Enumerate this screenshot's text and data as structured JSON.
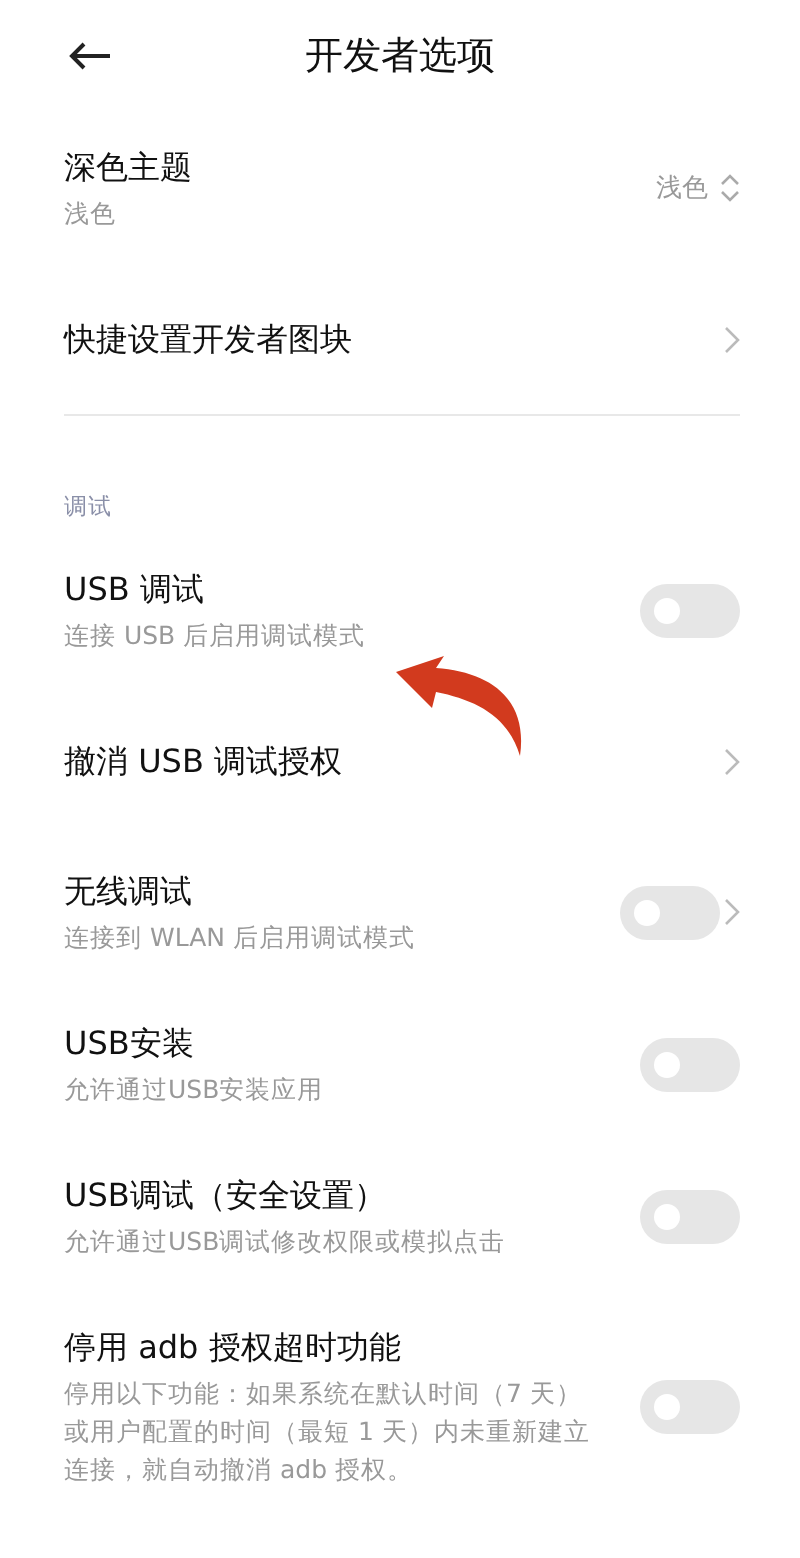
{
  "header": {
    "title": "开发者选项"
  },
  "groups": [
    {
      "items": [
        {
          "kind": "select",
          "title": "深色主题",
          "subtitle": "浅色",
          "value": "浅色"
        },
        {
          "kind": "link",
          "title": "快捷设置开发者图块"
        }
      ]
    },
    {
      "label": "调试",
      "items": [
        {
          "kind": "toggle",
          "title": "USB 调试",
          "subtitle": "连接 USB 后启用调试模式",
          "on": false
        },
        {
          "kind": "link",
          "title": "撤消 USB 调试授权"
        },
        {
          "kind": "toggle_link",
          "title": "无线调试",
          "subtitle": "连接到 WLAN 后启用调试模式",
          "on": false
        },
        {
          "kind": "toggle",
          "title": "USB安装",
          "subtitle": "允许通过USB安装应用",
          "on": false
        },
        {
          "kind": "toggle",
          "title": "USB调试（安全设置）",
          "subtitle": "允许通过USB调试修改权限或模拟点击",
          "on": false
        },
        {
          "kind": "toggle",
          "title": "停用 adb 授权超时功能",
          "subtitle": "停用以下功能：如果系统在默认时间（7 天）或用户配置的时间（最短 1 天）内未重新建立连接，就自动撤消 adb 授权。",
          "on": false
        }
      ]
    }
  ]
}
